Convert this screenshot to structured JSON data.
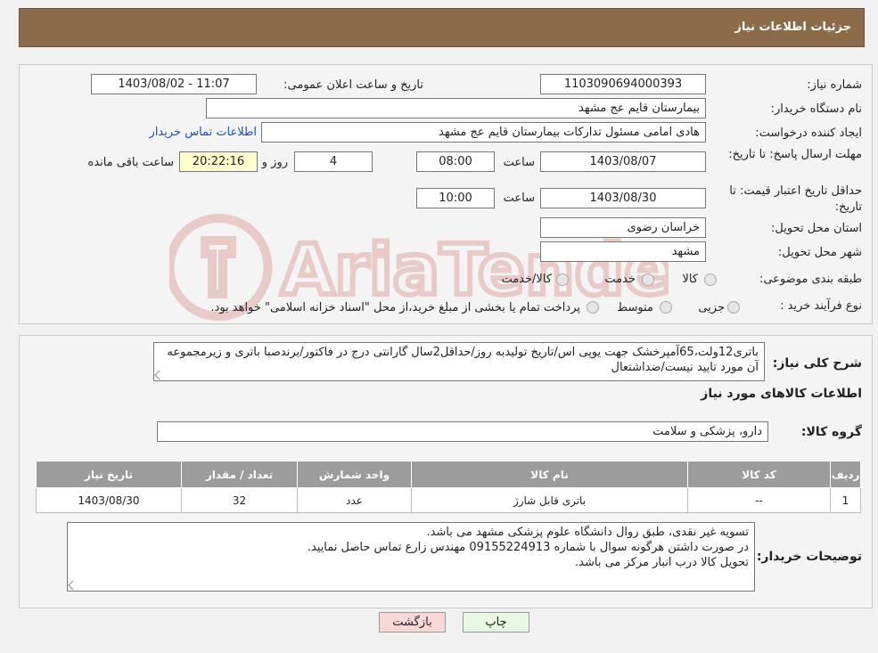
{
  "header": {
    "title": "جزئیات اطلاعات نیاز"
  },
  "form": {
    "need_number_label": "شماره نیاز:",
    "need_number": "1103090694000393",
    "announce_label": "تاریخ و ساعت اعلان عمومی:",
    "announce_value": "1403/08/02 - 11:07",
    "buyer_org_label": "نام دستگاه خریدار:",
    "buyer_org": "بیمارستان قایم  عج  مشهد",
    "creator_label": "ایجاد کننده درخواست:",
    "creator": "هادی امامی مسئول تدارکات بیمارستان قایم  عج  مشهد",
    "contact_link": "اطلاعات تماس خریدار",
    "deadline_label": "مهلت ارسال پاسخ: تا تاریخ:",
    "deadline_date": "1403/08/07",
    "time_label": "ساعت",
    "deadline_time": "08:00",
    "days_value": "4",
    "days_label": "روز و",
    "remaining_time": "20:22:16",
    "remaining_label": "ساعت باقی مانده",
    "validity_label": "حداقل تاریخ اعتبار قیمت: تا تاریخ:",
    "validity_date": "1403/08/30",
    "validity_time": "10:00",
    "province_label": "استان محل تحویل:",
    "province": "خراسان رضوی",
    "city_label": "شهر محل تحویل:",
    "city": "مشهد",
    "category_label": "طبقه بندی موضوعی:",
    "category_options": [
      "کالا",
      "خدمت",
      "کالا/خدمت"
    ],
    "process_label": "نوع فرآیند خرید :",
    "process_options": [
      "جزیی",
      "متوسط"
    ],
    "process_note": "پرداخت تمام یا بخشی از مبلغ خرید،از محل \"اسناد خزانه اسلامی\" خواهد بود."
  },
  "details": {
    "summary_label": "شرح کلی نیاز:",
    "summary": "باتری12ولت،65آمپرخشک جهت یوپی اس/تاریخ تولیدبه روز/حداقل2سال گارانتی درج در فاکتور/برندصبا باتری و زیرمجموعه آن مورد تایید نیست/ضداشتعال",
    "goods_info_title": "اطلاعات کالاهای مورد نیاز",
    "group_label": "گروه کالا:",
    "group_value": "دارو، پزشکی و سلامت",
    "table_headers": [
      "ردیف",
      "کد کالا",
      "نام کالا",
      "واحد شمارش",
      "تعداد / مقدار",
      "تاریخ نیاز"
    ],
    "table_rows": [
      [
        "1",
        "--",
        "باتری قابل شارژ",
        "عدد",
        "32",
        "1403/08/30"
      ]
    ],
    "buyer_notes_label": "توضیحات خریدار:",
    "buyer_notes": [
      "تسویه غیر نقدی، طبق روال دانشگاه علوم پزشکی مشهد می باشد.",
      "در صورت داشتن هرگونه سوال با  شماره 09155224913  مهندس  زارع تماس حاصل نمایید.",
      "تحویل کالا درب انبار مرکز می باشد."
    ]
  },
  "buttons": {
    "print": "چاپ",
    "back": "بازگشت"
  },
  "watermark": {
    "text": "AriaTender.neT",
    "color": "#c0392b"
  }
}
